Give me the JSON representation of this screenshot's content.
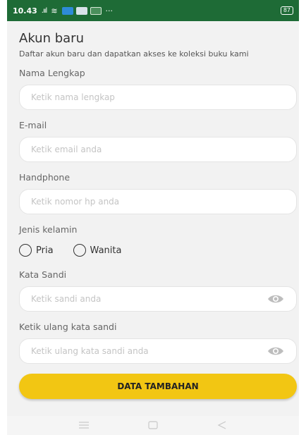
{
  "statusbar": {
    "time": "10.43",
    "signal": ".ııl",
    "wifi": "≋",
    "more": "···",
    "battery": "87"
  },
  "header": {
    "title": "Akun baru",
    "subtitle": "Daftar akun baru dan dapatkan akses ke koleksi buku kami"
  },
  "form": {
    "name_label": "Nama Lengkap",
    "name_placeholder": "Ketik nama lengkap",
    "email_label": "E-mail",
    "email_placeholder": "Ketik email anda",
    "phone_label": "Handphone",
    "phone_placeholder": "Ketik nomor hp anda",
    "gender_label": "Jenis kelamin",
    "gender_options": [
      "Pria",
      "Wanita"
    ],
    "password_label": "Kata Sandi",
    "password_placeholder": "Ketik sandi anda",
    "confirm_label": "Ketik ulang kata sandi",
    "confirm_placeholder": "Ketik ulang kata sandi anda",
    "submit_label": "DATA TAMBAHAN"
  },
  "colors": {
    "statusbar": "#1e6b36",
    "background": "#f2f2f2",
    "button": "#f2c613"
  },
  "icons": {
    "password_toggle": "eye-icon",
    "nav": [
      "menu-icon",
      "home-icon",
      "back-icon"
    ]
  }
}
